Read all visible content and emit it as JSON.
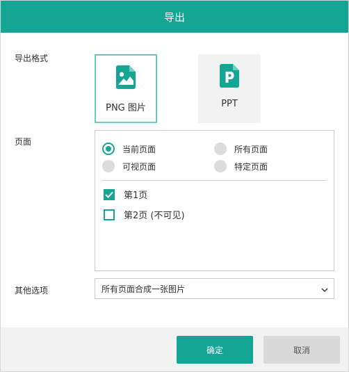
{
  "dialog": {
    "title": "导出"
  },
  "export_format": {
    "label": "导出格式",
    "options": [
      {
        "name": "PNG 图片",
        "icon": "image-file-icon",
        "selected": true
      },
      {
        "name": "PPT",
        "icon": "ppt-file-icon",
        "selected": false
      }
    ]
  },
  "pages": {
    "label": "页面",
    "radio_options": [
      {
        "label": "当前页面",
        "selected": true
      },
      {
        "label": "所有页面",
        "selected": false
      },
      {
        "label": "可视页面",
        "selected": false
      },
      {
        "label": "特定页面",
        "selected": false
      }
    ],
    "page_list": [
      {
        "label": "第1页",
        "checked": true
      },
      {
        "label": "第2页 (不可见)",
        "checked": false
      }
    ]
  },
  "other_options": {
    "label": "其他选项",
    "selected_value": "所有页面合成一张图片"
  },
  "footer": {
    "confirm_label": "确定",
    "cancel_label": "取消"
  },
  "colors": {
    "accent": "#14a595",
    "selected_border": "#6cc9be",
    "disabled_radio": "#dcdcdc",
    "footer_bg": "#f2f2f2"
  }
}
